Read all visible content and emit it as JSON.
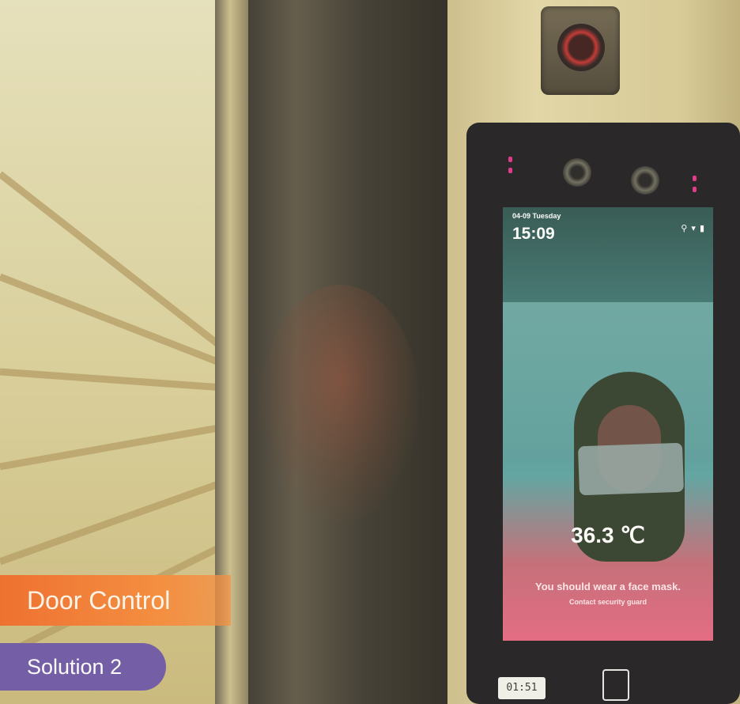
{
  "overlay": {
    "title_label": "Door Control",
    "subtitle_label": "Solution 2"
  },
  "device_screen": {
    "date": "04-09 Tuesday",
    "time": "15:09",
    "status_icons": "⚲ ▾ ▮",
    "temperature": "36.3 ℃",
    "warning": "You should wear a face mask.",
    "warning_sub": "Contact security guard"
  },
  "device_footer": {
    "clock": "01:51"
  },
  "colors": {
    "orange_tag": "#f06a28",
    "purple_tag": "#6c56a8",
    "led": "#e0308a"
  }
}
